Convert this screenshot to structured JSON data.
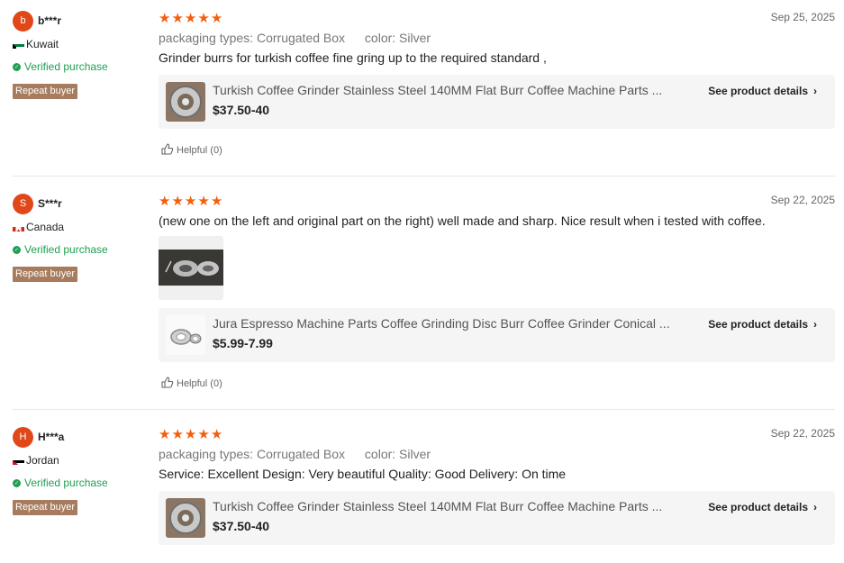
{
  "reviews": [
    {
      "avatar_letter": "b",
      "username": "b***r",
      "country": "Kuwait",
      "verified": "Verified purchase",
      "repeat": "Repeat buyer",
      "date": "Sep 25, 2025",
      "attr1_key": "packaging types:",
      "attr1_val": "Corrugated Box",
      "attr2_key": "color:",
      "attr2_val": "Silver",
      "text": "Grinder burrs for turkish coffee fine gring up to the required standard ,",
      "product_title": "Turkish Coffee Grinder Stainless Steel 140MM Flat Burr Coffee Machine Parts ...",
      "product_price": "$37.50-40",
      "details": "See product details",
      "helpful": "Helpful (0)"
    },
    {
      "avatar_letter": "S",
      "username": "S***r",
      "country": "Canada",
      "verified": "Verified purchase",
      "repeat": "Repeat buyer",
      "date": "Sep 22, 2025",
      "text": "(new one on the left and original part on the right) well made and sharp. Nice result when i tested with coffee.",
      "product_title": "Jura Espresso Machine Parts Coffee Grinding Disc Burr Coffee Grinder Conical ...",
      "product_price": "$5.99-7.99",
      "details": "See product details",
      "helpful": "Helpful (0)"
    },
    {
      "avatar_letter": "H",
      "username": "H***a",
      "country": "Jordan",
      "verified": "Verified purchase",
      "repeat": "Repeat buyer",
      "date": "Sep 22, 2025",
      "attr1_key": "packaging types:",
      "attr1_val": "Corrugated Box",
      "attr2_key": "color:",
      "attr2_val": "Silver",
      "text": "Service: Excellent Design: Very beautiful Quality: Good Delivery: On time",
      "product_title": "Turkish Coffee Grinder Stainless Steel 140MM Flat Burr Coffee Machine Parts ...",
      "product_price": "$37.50-40",
      "details": "See product details"
    }
  ],
  "icons": {
    "star": "star-icon",
    "verified": "check-circle-icon",
    "chevron": "chevron-right-icon",
    "helpful": "thumbs-up-icon"
  },
  "colors": {
    "star": "#f45e0c",
    "avatar": "#e0481a",
    "verified": "#1e9f52",
    "repeat_badge": "#a77c5e"
  },
  "rating": 5
}
